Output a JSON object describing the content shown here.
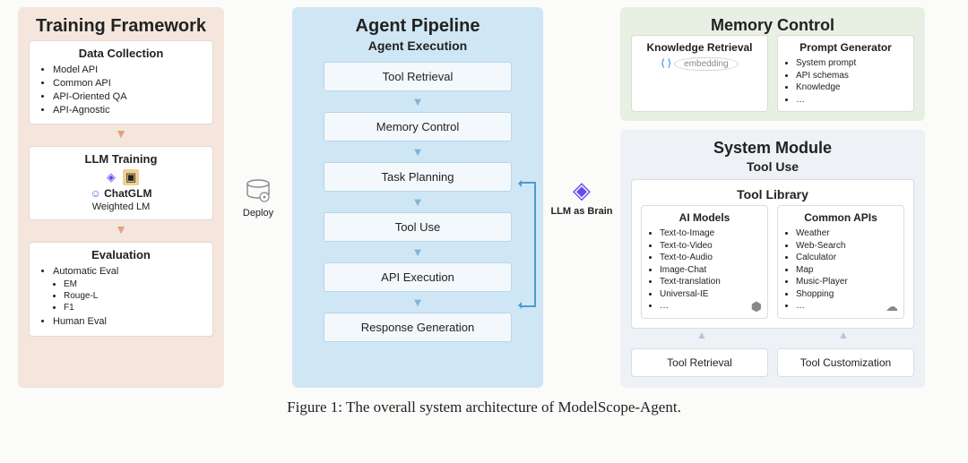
{
  "caption": "Figure 1: The overall system architecture of ModelScope-Agent.",
  "training": {
    "title": "Training Framework",
    "data_collection": {
      "heading": "Data Collection",
      "items": [
        "Model API",
        "Common API",
        "API-Oriented QA",
        "API-Agnostic"
      ]
    },
    "llm_training": {
      "heading": "LLM Training",
      "model_label": "ChatGLM",
      "method": "Weighted LM"
    },
    "evaluation": {
      "heading": "Evaluation",
      "items": [
        "Automatic Eval",
        "Human Eval"
      ],
      "auto_sub": [
        "EM",
        "Rouge-L",
        "F1"
      ]
    }
  },
  "deploy_label": "Deploy",
  "pipeline": {
    "title": "Agent Pipeline",
    "subtitle": "Agent Execution",
    "steps": [
      "Tool Retrieval",
      "Memory Control",
      "Task Planning",
      "Tool Use",
      "API Execution",
      "Response Generation"
    ]
  },
  "brain_label": "LLM as Brain",
  "memory": {
    "title": "Memory Control",
    "knowledge": {
      "heading": "Knowledge Retrieval",
      "embedding": "embedding"
    },
    "prompt": {
      "heading": "Prompt Generator",
      "items": [
        "System prompt",
        "API schemas",
        "Knowledge",
        "…"
      ]
    }
  },
  "system": {
    "title": "System Module",
    "subtitle": "Tool Use",
    "tool_library": "Tool Library",
    "ai_models": {
      "heading": "AI Models",
      "items": [
        "Text-to-Image",
        "Text-to-Video",
        "Text-to-Audio",
        "Image-Chat",
        "Text-translation",
        "Universal-IE",
        "…"
      ]
    },
    "common_apis": {
      "heading": "Common APIs",
      "items": [
        "Weather",
        "Web-Search",
        "Calculator",
        "Map",
        "Music-Player",
        "Shopping",
        "…"
      ]
    },
    "retrieval": "Tool Retrieval",
    "customization": "Tool Customization"
  }
}
